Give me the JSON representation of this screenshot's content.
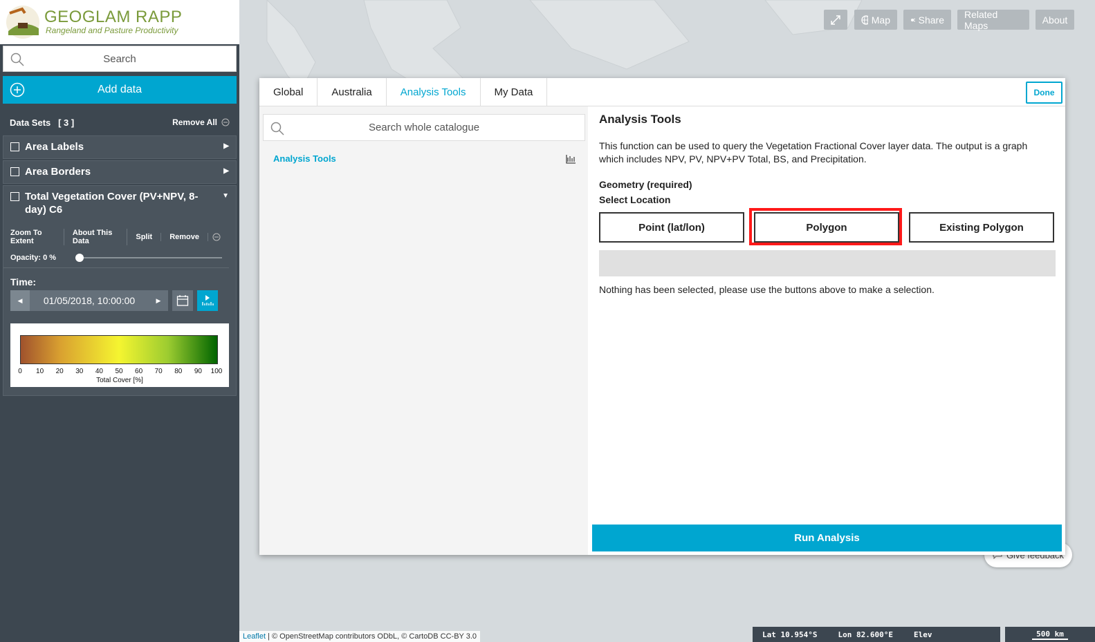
{
  "app": {
    "logo_title": "GEOGLAM RAPP",
    "logo_subtitle": "Rangeland and Pasture Productivity"
  },
  "topbar": {
    "fullscreen_icon": "expand-icon",
    "map_label": "Map",
    "share_label": "Share",
    "related_maps_label": "Related Maps",
    "about_label": "About"
  },
  "sidebar": {
    "search_placeholder": "Search",
    "add_data_label": "Add data",
    "datasets_label": "Data Sets",
    "datasets_count": "[ 3 ]",
    "remove_all_label": "Remove All",
    "layers": [
      {
        "name": "Area Labels"
      },
      {
        "name": "Area Borders"
      },
      {
        "name": "Total Vegetation Cover (PV+NPV, 8-day) C6"
      }
    ],
    "layer_tools": {
      "zoom": "Zoom To Extent",
      "about": "About This Data",
      "split": "Split",
      "remove": "Remove"
    },
    "opacity_label": "Opacity: 0 %",
    "opacity_value": 0,
    "time_label": "Time:",
    "time_value": "01/05/2018, 10:00:00",
    "legend": {
      "ticks": [
        "0",
        "10",
        "20",
        "30",
        "40",
        "50",
        "60",
        "70",
        "80",
        "90",
        "100"
      ],
      "caption": "Total Cover [%]",
      "colors": [
        "#a0522d",
        "#d9a030",
        "#f5f530",
        "#9ccc30",
        "#006400"
      ]
    }
  },
  "modal": {
    "tabs": [
      "Global",
      "Australia",
      "Analysis Tools",
      "My Data"
    ],
    "active_tab": "Analysis Tools",
    "done_label": "Done",
    "catalogue_search_placeholder": "Search whole catalogue",
    "catalogue_item": "Analysis Tools",
    "panel_title": "Analysis Tools",
    "description": "This function can be used to query the Vegetation Fractional Cover layer data. The output is a graph which includes NPV, PV, NPV+PV Total, BS, and Precipitation.",
    "geometry_label": "Geometry (required)",
    "select_location_label": "Select Location",
    "location_buttons": [
      "Point (lat/lon)",
      "Polygon",
      "Existing Polygon"
    ],
    "highlighted_button": "Polygon",
    "nothing_selected": "Nothing has been selected, please use the buttons above to make a selection.",
    "run_label": "Run Analysis"
  },
  "map": {
    "feedback_label": "Give feedback",
    "attribution_leaflet": "Leaflet",
    "attribution_rest": " | © OpenStreetMap contributors ODbL, © CartoDB CC-BY 3.0",
    "lat": "Lat  10.954°S",
    "lon": "Lon  82.600°E",
    "elev": "Elev",
    "scale": "500 km"
  },
  "colors": {
    "accent": "#00a6d0",
    "sidebar_bg": "#3d4750",
    "highlight": "#ff1a1a"
  }
}
